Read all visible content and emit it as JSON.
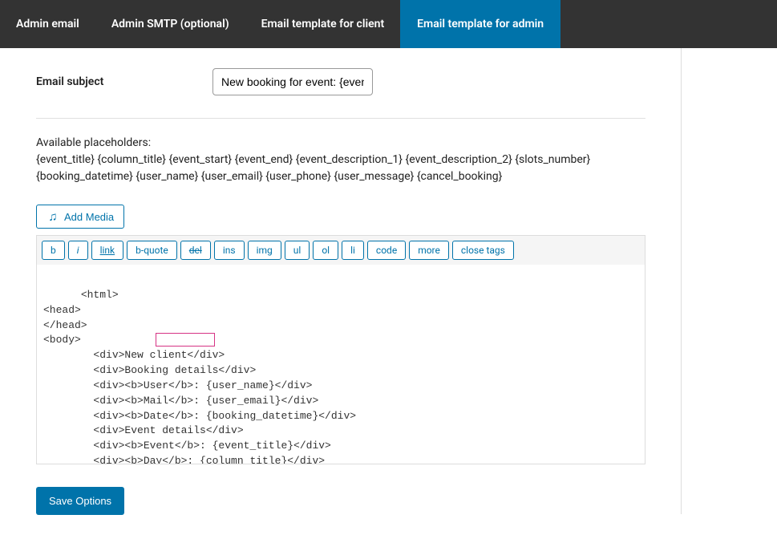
{
  "tabs": {
    "items": [
      {
        "label": "Admin email",
        "active": false
      },
      {
        "label": "Admin SMTP (optional)",
        "active": false
      },
      {
        "label": "Email template for client",
        "active": false
      },
      {
        "label": "Email template for admin",
        "active": true
      }
    ]
  },
  "subject": {
    "label": "Email subject",
    "value": "New booking for event: {even"
  },
  "placeholders": {
    "title": "Available placeholders:",
    "list": "{event_title} {column_title} {event_start} {event_end} {event_description_1} {event_description_2} {slots_number} {booking_datetime} {user_name} {user_email} {user_phone} {user_message} {cancel_booking}"
  },
  "add_media_label": "Add Media",
  "toolbar": {
    "b": "b",
    "i": "i",
    "link": "link",
    "bquote": "b-quote",
    "del": "del",
    "ins": "ins",
    "img": "img",
    "ul": "ul",
    "ol": "ol",
    "li": "li",
    "code": "code",
    "more": "more",
    "close": "close tags"
  },
  "editor_content": "<html>\n<head>\n</head>\n<body>\n        <div>New client</div>\n        <div>Booking details</div>\n        <div><b>User</b>: {user_name}</div>\n        <div><b>Mail</b>: {user_email}</div>\n        <div><b>Date</b>: {booking_datetime}</div>\n        <div>Event details</div>\n        <div><b>Event</b>: {event_title}</div>\n        <div><b>Day</b>: {column_title}</div>\n        <div><b>Time</b>: {event_start} - {event_end}</div>",
  "save_label": "Save Options"
}
